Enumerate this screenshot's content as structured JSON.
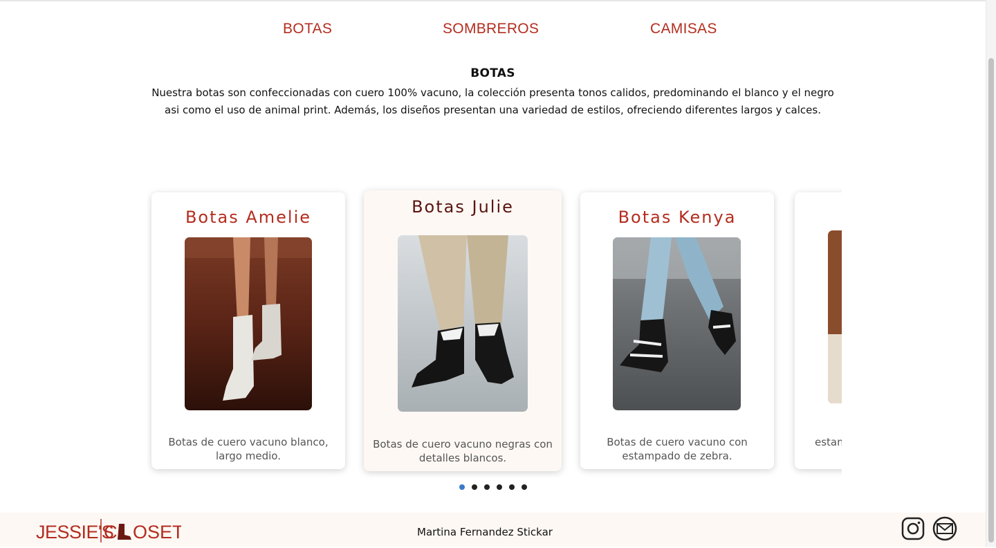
{
  "nav": {
    "items": [
      {
        "label": "BOTAS"
      },
      {
        "label": "SOMBREROS"
      },
      {
        "label": "CAMISAS"
      }
    ]
  },
  "section": {
    "title": "BOTAS",
    "description": "Nuestra botas son confeccionadas con cuero 100% vacuno, la colección presenta tonos calidos, predominando el blanco y el negro asi como el uso de animal print. Además, los diseños presentan una variedad de estilos, ofreciendo diferentes largos y calces."
  },
  "carousel": {
    "cards": [
      {
        "title": "Botas Amelie",
        "description": "Botas de cuero vacuno blanco, largo medio."
      },
      {
        "title": "Botas Julie",
        "description": "Botas de cuero vacuno negras con detalles blancos."
      },
      {
        "title": "Botas Kenya",
        "description": "Botas de cuero vacuno con estampado de zebra."
      },
      {
        "title": "",
        "description": "estam"
      }
    ],
    "dots_total": 6,
    "active_dot": 1
  },
  "footer": {
    "logo_text": "JESSIE'S CLOSET",
    "author": "Martina Fernandez Stickar",
    "icons": [
      "instagram-icon",
      "mail-icon"
    ]
  },
  "colors": {
    "accent": "#b32d1f",
    "accent_dark": "#5a1410",
    "footer_bg": "#fdf8f4",
    "dot_active": "#3a7ac9"
  }
}
